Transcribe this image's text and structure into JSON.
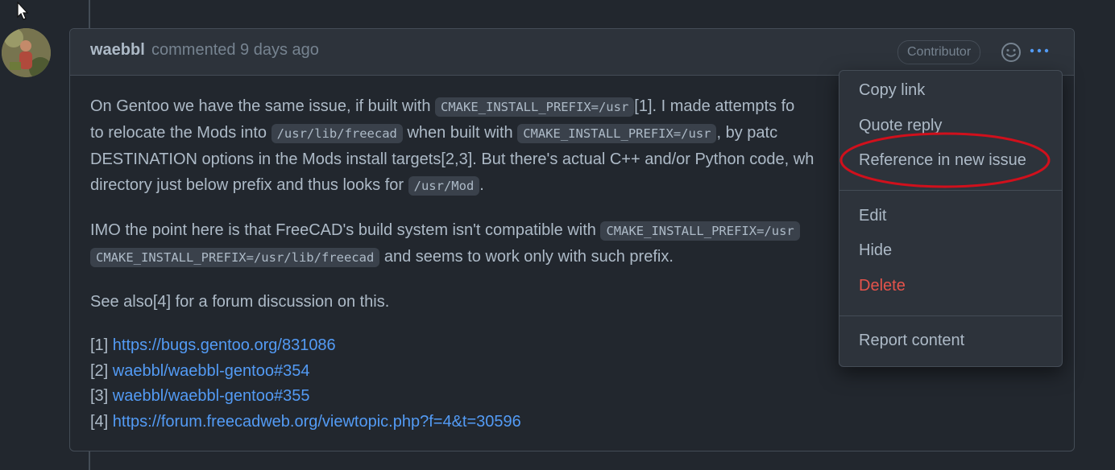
{
  "comment": {
    "author": "waebbl",
    "meta": "commented 9 days ago",
    "badge": "Contributor",
    "paragraphs": {
      "p1": {
        "t1": "On Gentoo we have the same issue, if built with ",
        "c1": "CMAKE_INSTALL_PREFIX=/usr",
        "t2": "[1]. I made attempts fo",
        "t3": "to relocate the Mods into ",
        "c2": "/usr/lib/freecad",
        "t4": " when built with ",
        "c3": "CMAKE_INSTALL_PREFIX=/usr",
        "t5": ", by patc",
        "t6": "DESTINATION options in the Mods install targets[2,3]. But there's actual C++ and/or Python code, wh",
        "t7": "directory just below prefix and thus looks for ",
        "c4": "/usr/Mod",
        "t8": "."
      },
      "p2": {
        "t1": "IMO the point here is that FreeCAD's build system isn't compatible with ",
        "c1": "CMAKE_INSTALL_PREFIX=/usr",
        "c2": "CMAKE_INSTALL_PREFIX=/usr/lib/freecad",
        "t2": " and seems to work only with such prefix."
      },
      "p3": "See also[4] for a forum discussion on this."
    },
    "refs": [
      {
        "num": "[1] ",
        "link": "https://bugs.gentoo.org/831086"
      },
      {
        "num": "[2] ",
        "link": "waebbl/waebbl-gentoo#354"
      },
      {
        "num": "[3] ",
        "link": "waebbl/waebbl-gentoo#355"
      },
      {
        "num": "[4] ",
        "link": "https://forum.freecadweb.org/viewtopic.php?f=4&t=30596"
      }
    ]
  },
  "menu": {
    "copy_link": "Copy link",
    "quote_reply": "Quote reply",
    "reference": "Reference in new issue",
    "edit": "Edit",
    "hide": "Hide",
    "delete": "Delete",
    "report": "Report content"
  },
  "icons": {
    "smiley": "smiley-icon",
    "kebab": "kebab-horizontal-icon",
    "cursor": "mouse-pointer-icon"
  },
  "colors": {
    "background": "#22272e",
    "header": "#2d333b",
    "link": "#539bf5",
    "danger": "#e5534b",
    "annotation": "#d0101c"
  }
}
